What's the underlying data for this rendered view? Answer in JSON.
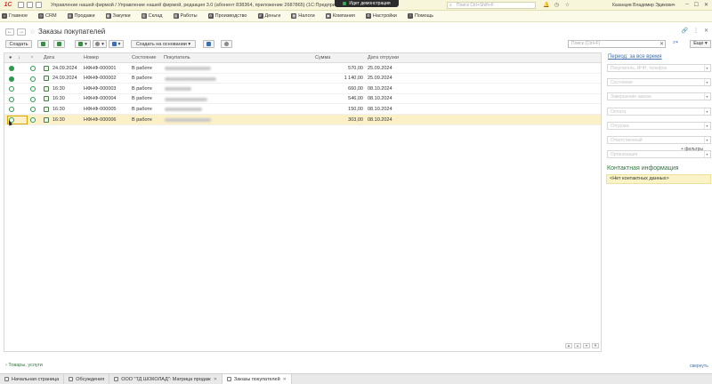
{
  "app": {
    "logo": "1С",
    "title": "Управление нашей фирмой / Управление нашей фирмой, редакция 3.0 (абонент 838364, приложение 2687865)  (1С:Предприятие)",
    "demo_badge": "Идет демонстрация",
    "search_placeholder": "Поиск Ctrl+Shift+F",
    "user": "Казанцев Владимир Эдикович"
  },
  "menu": [
    {
      "label": "Главное",
      "icon": "home-icon"
    },
    {
      "label": "CRM",
      "icon": "crm-icon"
    },
    {
      "label": "Продажи",
      "icon": "sales-icon"
    },
    {
      "label": "Закупки",
      "icon": "purchases-icon"
    },
    {
      "label": "Склад",
      "icon": "warehouse-icon"
    },
    {
      "label": "Работы",
      "icon": "works-icon"
    },
    {
      "label": "Производство",
      "icon": "production-icon"
    },
    {
      "label": "Деньги",
      "icon": "money-icon"
    },
    {
      "label": "Налоги",
      "icon": "taxes-icon"
    },
    {
      "label": "Компания",
      "icon": "company-icon"
    },
    {
      "label": "Настройки",
      "icon": "settings-icon"
    },
    {
      "label": "Помощь",
      "icon": "help-icon"
    }
  ],
  "form": {
    "title": "Заказы покупателей",
    "create_label": "Создать",
    "create_based_label": "Создать на основании ▾",
    "search_placeholder": "Поиск (Ctrl+F)",
    "more_label": "Еще ▾"
  },
  "table": {
    "columns": [
      "Дата",
      "Номер",
      "Состояние",
      "Покупатель",
      "Сумма",
      "Дата отгрузки"
    ],
    "rows": [
      {
        "date": "24.09.2024",
        "number": "НФНФ-000001",
        "state": "В работе",
        "sum": "570,00",
        "ship": "25.09.2024",
        "paid": true
      },
      {
        "date": "24.09.2024",
        "number": "НФНФ-000002",
        "state": "В работе",
        "sum": "1 140,00",
        "ship": "25.09.2024",
        "paid": true
      },
      {
        "date": "16:30",
        "number": "НФНФ-000003",
        "state": "В работе",
        "sum": "660,00",
        "ship": "08.10.2024",
        "paid": false
      },
      {
        "date": "16:30",
        "number": "НФНФ-000004",
        "state": "В работе",
        "sum": "546,00",
        "ship": "08.10.2024",
        "paid": false
      },
      {
        "date": "16:30",
        "number": "НФНФ-000005",
        "state": "В работе",
        "sum": "150,00",
        "ship": "08.10.2024",
        "paid": false
      },
      {
        "date": "16:30",
        "number": "НФНФ-000006",
        "state": "В работе",
        "sum": "303,00",
        "ship": "08.10.2024",
        "paid": false
      }
    ]
  },
  "filters": {
    "period": "Период: за все время",
    "fields": [
      "Покупатель, ИНН, телефон",
      "Состояние",
      "Завершение заказа",
      "Оплата",
      "Отгрузка",
      "Ответственный",
      "Организация"
    ],
    "more_filters": "+ фильтры"
  },
  "contact": {
    "title": "Контактная информация",
    "empty": "<Нет контактных данных>"
  },
  "bottom": {
    "goods_link": "Товары, услуги",
    "collapse": "свернуть"
  },
  "tabs": [
    {
      "label": "Начальная страница",
      "closable": false,
      "active": false
    },
    {
      "label": "Обсуждения",
      "closable": false,
      "active": false
    },
    {
      "label": "ООО \"ТД ШОКОЛАД\": Матрица продаж",
      "closable": true,
      "active": false
    },
    {
      "label": "Заказы покупателей",
      "closable": true,
      "active": true
    }
  ],
  "colors": {
    "accent_green": "#2b9a4c",
    "link_blue": "#3b6fb0",
    "selected_row": "#fbf0c8",
    "titlebar": "#f7f5da"
  }
}
